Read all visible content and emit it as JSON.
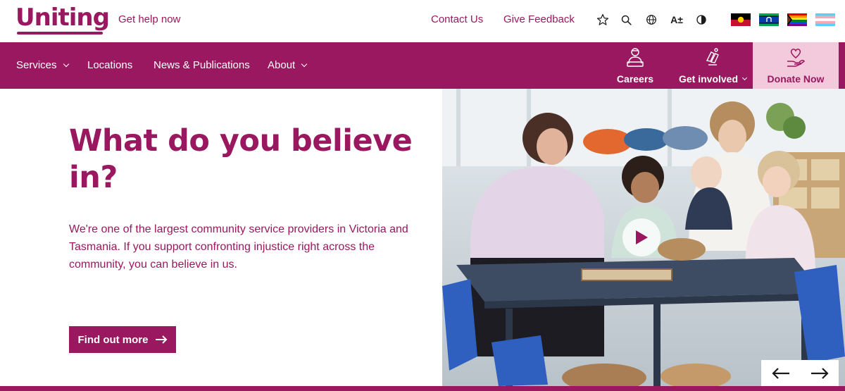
{
  "brand": {
    "logo_text": "Uniting",
    "accent": "#99185f",
    "donate_bg": "#f3c9dc"
  },
  "topbar": {
    "get_help": "Get help now",
    "contact": "Contact Us",
    "feedback": "Give Feedback",
    "icons": [
      "star-icon",
      "search-icon",
      "globe-icon",
      "text-size-icon",
      "contrast-icon"
    ],
    "text_size_glyph": "A±",
    "flags": [
      "aboriginal-flag",
      "torres-strait-islander-flag",
      "progress-pride-flag",
      "transgender-flag"
    ]
  },
  "nav": {
    "services": "Services",
    "locations": "Locations",
    "news": "News & Publications",
    "about": "About",
    "careers": "Careers",
    "get_involved": "Get involved",
    "donate": "Donate Now"
  },
  "hero": {
    "title": "What do you believe in?",
    "body": "We're one of the largest community service providers in Victoria and Tasmania. If you support confronting injustice right across the community, you can believe in us.",
    "cta": "Find out more"
  },
  "media": {
    "play_icon": "play-icon",
    "prev_icon": "arrow-left-icon",
    "next_icon": "arrow-right-icon"
  }
}
